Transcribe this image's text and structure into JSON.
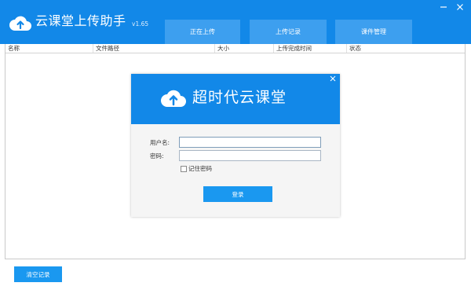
{
  "app": {
    "title": "云课堂上传助手",
    "version": "v1.65"
  },
  "tabs": [
    {
      "label": "正在上传"
    },
    {
      "label": "上传记录"
    },
    {
      "label": "课件管理"
    }
  ],
  "window_controls": {
    "minimize": "—",
    "close": "✕"
  },
  "table": {
    "columns": [
      "名称",
      "文件路径",
      "大小",
      "上传完成时间",
      "状态"
    ]
  },
  "login_dialog": {
    "title": "超时代云课堂",
    "close": "×",
    "username_label": "用户名:",
    "password_label": "密码:",
    "username_value": "",
    "password_value": "",
    "remember_label": "记住密码",
    "remember_checked": false,
    "login_button": "登录"
  },
  "footer": {
    "clear_button": "清空记录"
  },
  "colors": {
    "brand_blue": "#1288e8",
    "tab_blue": "#3d9fef",
    "button_blue": "#1a98f0"
  }
}
